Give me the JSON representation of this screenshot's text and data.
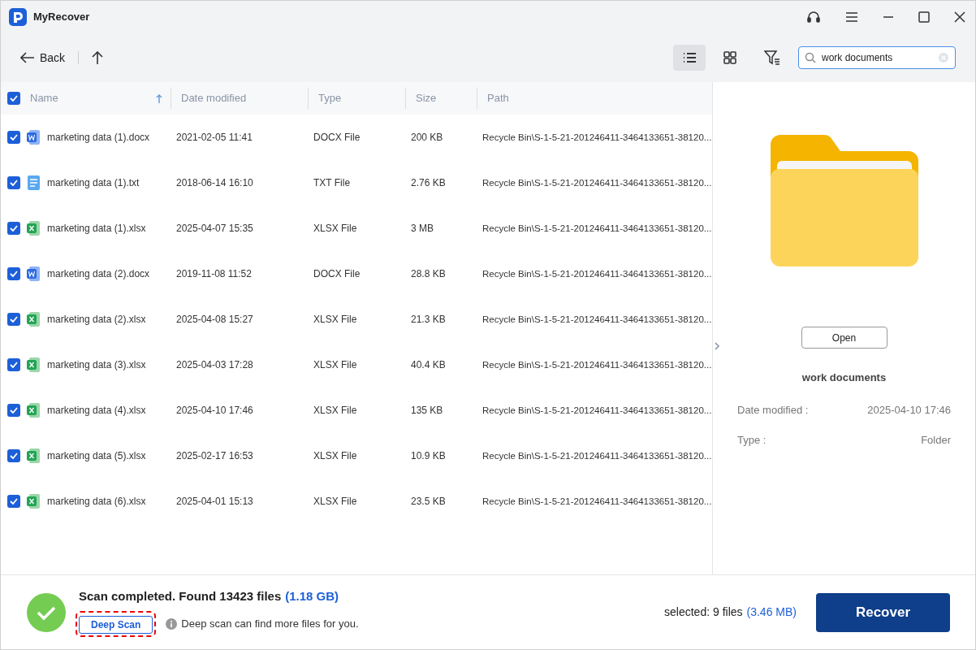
{
  "window": {
    "title": "MyRecover"
  },
  "toolbar": {
    "back": "Back",
    "views": [
      {
        "kind": "list",
        "selected": true
      },
      {
        "kind": "grid",
        "selected": false
      }
    ],
    "search": {
      "value": "work documents"
    }
  },
  "table": {
    "all_checked": true,
    "columns": [
      "Name",
      "Date modified",
      "Type",
      "Size",
      "Path"
    ],
    "rows": [
      {
        "kind": "word",
        "checked": true,
        "name": "marketing data (1).docx",
        "date": "2021-02-05 11:41",
        "type": "DOCX File",
        "size": "200 KB",
        "path": "Recycle Bin\\S-1-5-21-201246411-3464133651-38120..."
      },
      {
        "kind": "text",
        "checked": true,
        "name": "marketing data (1).txt",
        "date": "2018-06-14 16:10",
        "type": "TXT File",
        "size": "2.76 KB",
        "path": "Recycle Bin\\S-1-5-21-201246411-3464133651-38120..."
      },
      {
        "kind": "excel",
        "checked": true,
        "name": "marketing data (1).xlsx",
        "date": "2025-04-07 15:35",
        "type": "XLSX File",
        "size": "3 MB",
        "path": "Recycle Bin\\S-1-5-21-201246411-3464133651-38120..."
      },
      {
        "kind": "word",
        "checked": true,
        "name": "marketing data (2).docx",
        "date": "2019-11-08 11:52",
        "type": "DOCX File",
        "size": "28.8 KB",
        "path": "Recycle Bin\\S-1-5-21-201246411-3464133651-38120..."
      },
      {
        "kind": "excel",
        "checked": true,
        "name": "marketing data (2).xlsx",
        "date": "2025-04-08 15:27",
        "type": "XLSX File",
        "size": "21.3 KB",
        "path": "Recycle Bin\\S-1-5-21-201246411-3464133651-38120..."
      },
      {
        "kind": "excel",
        "checked": true,
        "name": "marketing data (3).xlsx",
        "date": "2025-04-03 17:28",
        "type": "XLSX File",
        "size": "40.4 KB",
        "path": "Recycle Bin\\S-1-5-21-201246411-3464133651-38120..."
      },
      {
        "kind": "excel",
        "checked": true,
        "name": "marketing data (4).xlsx",
        "date": "2025-04-10 17:46",
        "type": "XLSX File",
        "size": "135 KB",
        "path": "Recycle Bin\\S-1-5-21-201246411-3464133651-38120..."
      },
      {
        "kind": "excel",
        "checked": true,
        "name": "marketing data (5).xlsx",
        "date": "2025-02-17 16:53",
        "type": "XLSX File",
        "size": "10.9 KB",
        "path": "Recycle Bin\\S-1-5-21-201246411-3464133651-38120..."
      },
      {
        "kind": "excel",
        "checked": true,
        "name": "marketing data (6).xlsx",
        "date": "2025-04-01 15:13",
        "type": "XLSX File",
        "size": "23.5 KB",
        "path": "Recycle Bin\\S-1-5-21-201246411-3464133651-38120..."
      }
    ]
  },
  "preview": {
    "open": "Open",
    "name": "work documents",
    "details": [
      {
        "label": "Date modified :",
        "value": "2025-04-10 17:46"
      },
      {
        "label": "Type :",
        "value": "Folder"
      }
    ]
  },
  "footer": {
    "status": "Scan completed. Found 13423 files",
    "status_size": "(1.18 GB)",
    "deep_scan": "Deep Scan",
    "hint": "Deep scan can find more files for you.",
    "selected": "selected: 9 files",
    "selected_size": "(3.46 MB)",
    "recover": "Recover"
  }
}
